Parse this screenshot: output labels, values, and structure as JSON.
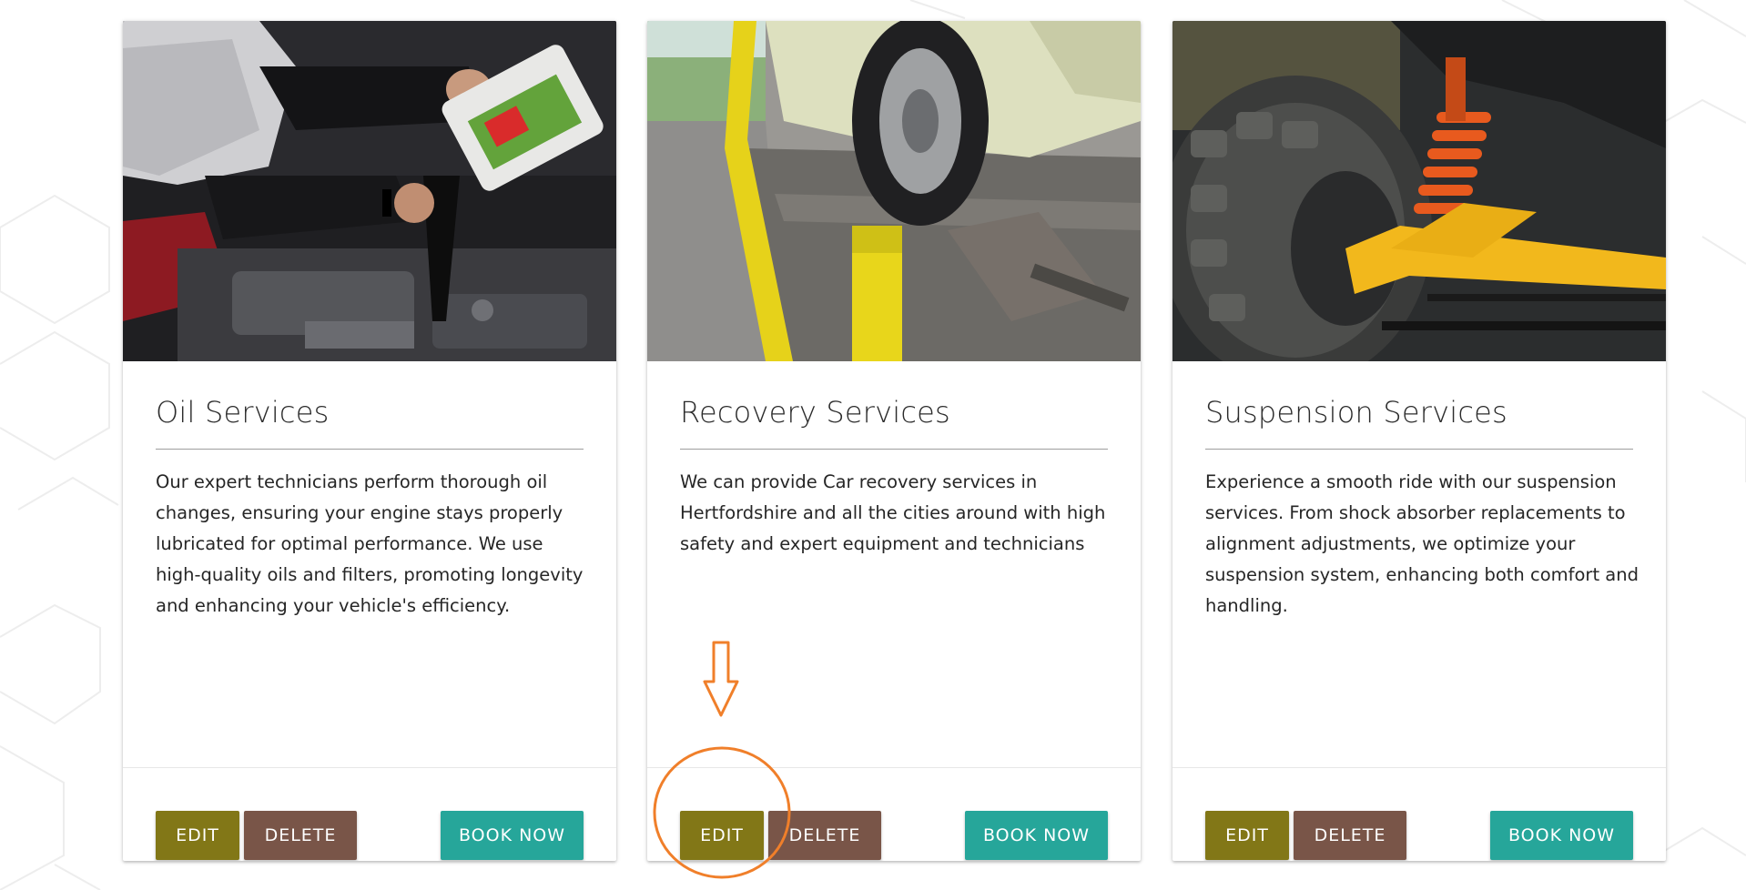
{
  "colors": {
    "edit_button": "#827717",
    "delete_button": "#795548",
    "book_button": "#26a69a",
    "annotation": "#f07f2a"
  },
  "cards": [
    {
      "title": "Oil Services",
      "text": "Our expert technicians perform thorough oil changes, ensuring your engine stays properly lubricated for optimal performance. We use high-quality oils and filters, promoting longevity and enhancing your vehicle's efficiency.",
      "image_icon": "oil-change-photo",
      "edit_label": "EDIT",
      "delete_label": "DELETE",
      "book_label": "BOOK NOW"
    },
    {
      "title": "Recovery Services",
      "text": "We can provide Car recovery services in Hertfordshire and all the cities around with high safety and expert equipment and technicians",
      "image_icon": "tow-truck-photo",
      "edit_label": "EDIT",
      "delete_label": "DELETE",
      "book_label": "BOOK NOW"
    },
    {
      "title": "Suspension Services",
      "text": "Experience a smooth ride with our suspension services. From shock absorber replacements to alignment adjustments, we optimize your suspension system, enhancing both comfort and handling.",
      "image_icon": "suspension-photo",
      "edit_label": "EDIT",
      "delete_label": "DELETE",
      "book_label": "BOOK NOW"
    }
  ],
  "annotation": {
    "icon": "down-arrow-icon",
    "highlight": "edit-button-circle"
  }
}
